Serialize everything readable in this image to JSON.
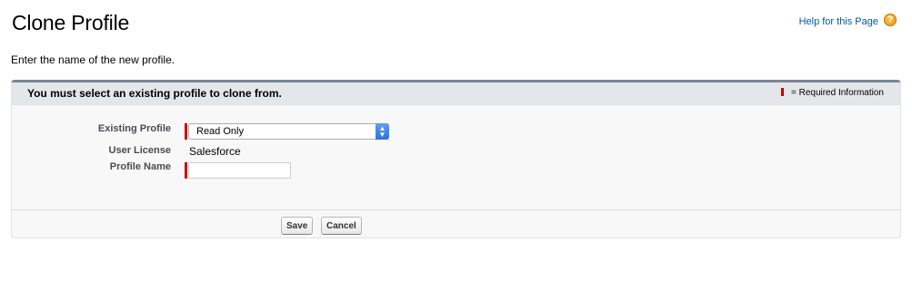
{
  "header": {
    "title": "Clone Profile",
    "help_link": "Help for this Page",
    "help_icon": "?"
  },
  "instruction": "Enter the name of the new profile.",
  "panel": {
    "title": "You must select an existing profile to clone from.",
    "required_legend": "= Required Information",
    "required_color": "#cc0000",
    "fields": {
      "existing_profile": {
        "label": "Existing Profile",
        "value": "Read Only"
      },
      "user_license": {
        "label": "User License",
        "value": "Salesforce"
      },
      "profile_name": {
        "label": "Profile Name",
        "value": ""
      }
    },
    "buttons": {
      "save": "Save",
      "cancel": "Cancel"
    }
  }
}
